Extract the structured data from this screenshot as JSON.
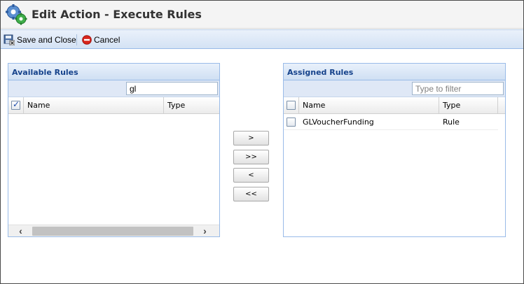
{
  "window": {
    "title": "Edit Action - Execute Rules"
  },
  "toolbar": {
    "save_label": "Save and Close",
    "save_icon": "save-close-icon",
    "cancel_label": "Cancel",
    "cancel_icon": "cancel-icon"
  },
  "available": {
    "title": "Available Rules",
    "filter_value": "gl",
    "columns": [
      "Name",
      "Type"
    ],
    "select_all_checked": true,
    "rows": []
  },
  "assigned": {
    "title": "Assigned Rules",
    "filter_placeholder": "Type to filter",
    "columns": [
      "Name",
      "Type"
    ],
    "select_all_checked": false,
    "rows": [
      {
        "name": "GLVoucherFunding",
        "type": "Rule",
        "checked": false
      }
    ]
  },
  "move_buttons": {
    "add": ">",
    "add_all": ">>",
    "remove": "<",
    "remove_all": "<<"
  },
  "colors": {
    "panel_border": "#99bbe8",
    "panel_title": "#15428b",
    "toolbar_bg": "#d4e2f4",
    "cancel_red": "#d9251c"
  }
}
